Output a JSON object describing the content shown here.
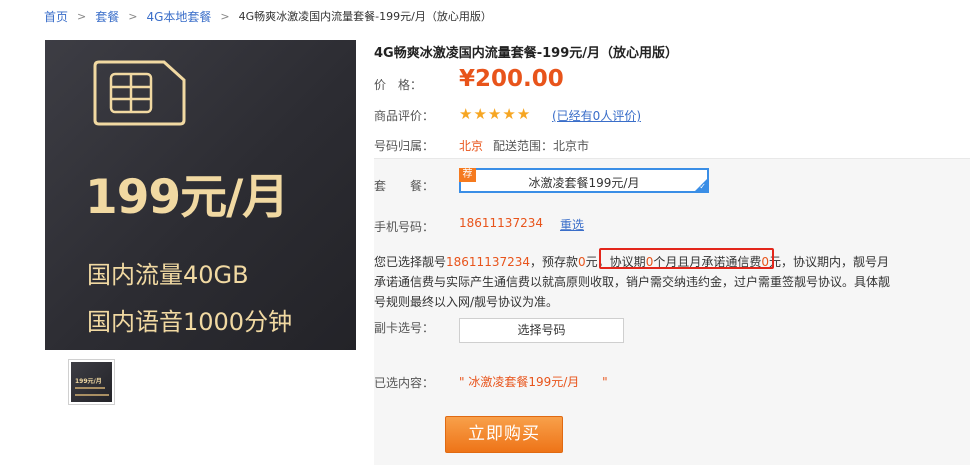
{
  "breadcrumb": {
    "items": [
      "首页",
      "套餐",
      "4G本地套餐"
    ],
    "current": "4G畅爽冰激凌国内流量套餐-199元/月（放心用版）"
  },
  "hero": {
    "price_text": "199元/月",
    "line1": "国内流量40GB",
    "line2": "国内语音1000分钟"
  },
  "thumbnail": {
    "price_text": "199元/月"
  },
  "product": {
    "title": "4G畅爽冰激凌国内流量套餐-199元/月（放心用版）",
    "price_label": "价　格：",
    "price": "¥200.00",
    "rating_label": "商品评价：",
    "rating_stars": 5,
    "review_text": "(已经有0人评价)",
    "location_label": "号码归属：",
    "city": "北京",
    "delivery_text": "配送范围：北京市"
  },
  "order": {
    "package_label": "套　　餐：",
    "package_tag": "荐",
    "package_value": "冰激凌套餐199元/月",
    "phone_label": "手机号码：",
    "phone_number": "18611137234",
    "reselect_label": "重选",
    "agreement": {
      "p1": "您已选择靓号",
      "num": "18611137234",
      "p2": "，预存款",
      "deposit": "0",
      "p3": "元，",
      "box_a": "协议期",
      "months": "0",
      "box_b": "个月且月承诺通信费",
      "fee": "0",
      "box_c": "元",
      "p4": "，协议期内，靓号月承诺通信费与实际产生通信费以就高原则收取，销户需交纳违约金，过户需重签靓号协议。具体靓号规则最终以入网/靓号协议为准。"
    },
    "subcard_label": "副卡选号：",
    "select_number_button": "选择号码",
    "chosen_label": "已选内容：",
    "chosen_value": "\" 冰激凌套餐199元/月      \"",
    "buy_button": "立即购买"
  },
  "colors": {
    "accent_orange": "#e8541b",
    "link_blue": "#3a6ec9",
    "highlight_red": "#e3261b",
    "gold": "#f1d9a2"
  }
}
